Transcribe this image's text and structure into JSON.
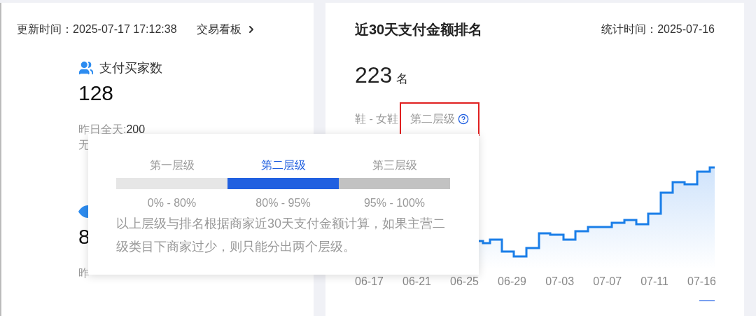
{
  "left_panel": {
    "update_label": "更新时间：",
    "update_time": "2025-07-17 17:12:38",
    "dashboard_link": "交易看板",
    "metrics": [
      {
        "title": "支付买家数",
        "value": "128",
        "yesterday_label": "昨日全天: ",
        "yesterday_value": "200",
        "note": "无"
      },
      {
        "value": "8",
        "yesterday_label": "昨"
      }
    ]
  },
  "right_panel": {
    "title": "近30天支付金额排名",
    "stat_label": "统计时间：",
    "stat_date": "2025-07-16",
    "rank": "223",
    "rank_unit": "名",
    "category": "鞋 - 女鞋",
    "tier": "第二层级",
    "highlighted": true,
    "x_labels": [
      "06-17",
      "06-21",
      "06-25",
      "06-29",
      "07-03",
      "07-07",
      "07-11",
      "07-16"
    ]
  },
  "popover": {
    "tiers": [
      {
        "label": "第一层级",
        "range": "0% - 80%",
        "selected": false,
        "color": "#e6e6e6"
      },
      {
        "label": "第二层级",
        "range": "80% - 95%",
        "selected": true,
        "color": "#2160e0"
      },
      {
        "label": "第三层级",
        "range": "95% - 100%",
        "selected": false,
        "color": "#c2c2c2"
      }
    ],
    "note": "以上层级与排名根据商家近30天支付金额计算，如果主营二级类目下商家过少，则只能分出两个层级。"
  }
}
